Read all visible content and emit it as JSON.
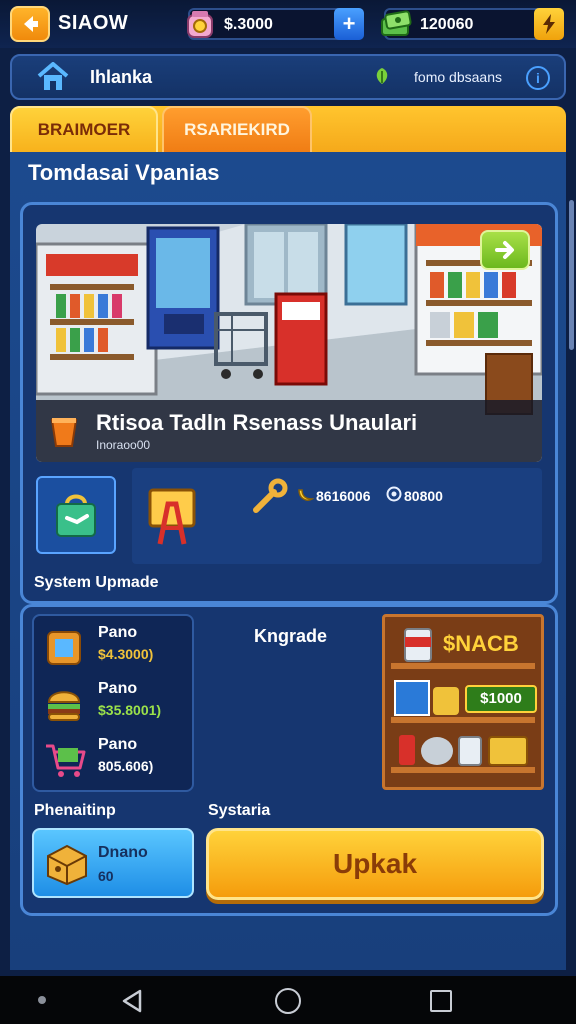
{
  "header": {
    "back_icon": "arrow-left-icon",
    "title": "SIAOW",
    "currency1": {
      "icon": "coin-jar-icon",
      "value": "$.3000",
      "add_icon": "plus-icon"
    },
    "currency2": {
      "icon": "cash-stack-icon",
      "value": "120060",
      "boost_icon": "lightning-icon"
    }
  },
  "location": {
    "home_icon": "home-icon",
    "label": "Ihlanka",
    "status_icon": "leaf-icon",
    "status": "fomo dbsaans",
    "info_icon": "info-icon"
  },
  "tabs": [
    {
      "label": "BRAIMOER",
      "active": true
    },
    {
      "label": "RSARIEKIRD",
      "active": false
    }
  ],
  "section": {
    "title": "Tomdasai Vpanias"
  },
  "scene": {
    "next_icon": "arrow-right-icon",
    "caption_icon": "cup-icon",
    "caption_title": "Rtisoa Tadln  Rsenass Unaulari",
    "caption_sub": "Inoraoo00"
  },
  "upgrades": {
    "icon1": "shopping-bag-icon",
    "icon2": "signboard-icon",
    "icon3": "wrench-icon",
    "stat1_icon": "banana-icon",
    "stat1": "8616006",
    "stat2_icon": "coin-icon",
    "stat2": "80800",
    "label": "System Upmade"
  },
  "list": [
    {
      "icon": "picture-frame-icon",
      "name": "Pano",
      "price": "$4.3000)",
      "price_color": "#f0c23a"
    },
    {
      "icon": "burger-icon",
      "name": "Pano",
      "price": "$35.8001)",
      "price_color": "#9be24a"
    },
    {
      "icon": "cart-icon",
      "name": "Pano",
      "price": "805.606)",
      "price_color": "#ffffff"
    }
  ],
  "upgrade_heading": "Kngrade",
  "shelf": {
    "sign": "$NACB",
    "price": "$1000"
  },
  "footer": {
    "label_left": "Phenaitinp",
    "label_right": "Systaria",
    "item_icon": "box-icon",
    "item_name": "Dnano",
    "item_value": "60",
    "main_button": "Upkak"
  },
  "colors": {
    "accent": "#f5a81a",
    "panel": "#1c4a8e",
    "border": "#4a86d6"
  }
}
